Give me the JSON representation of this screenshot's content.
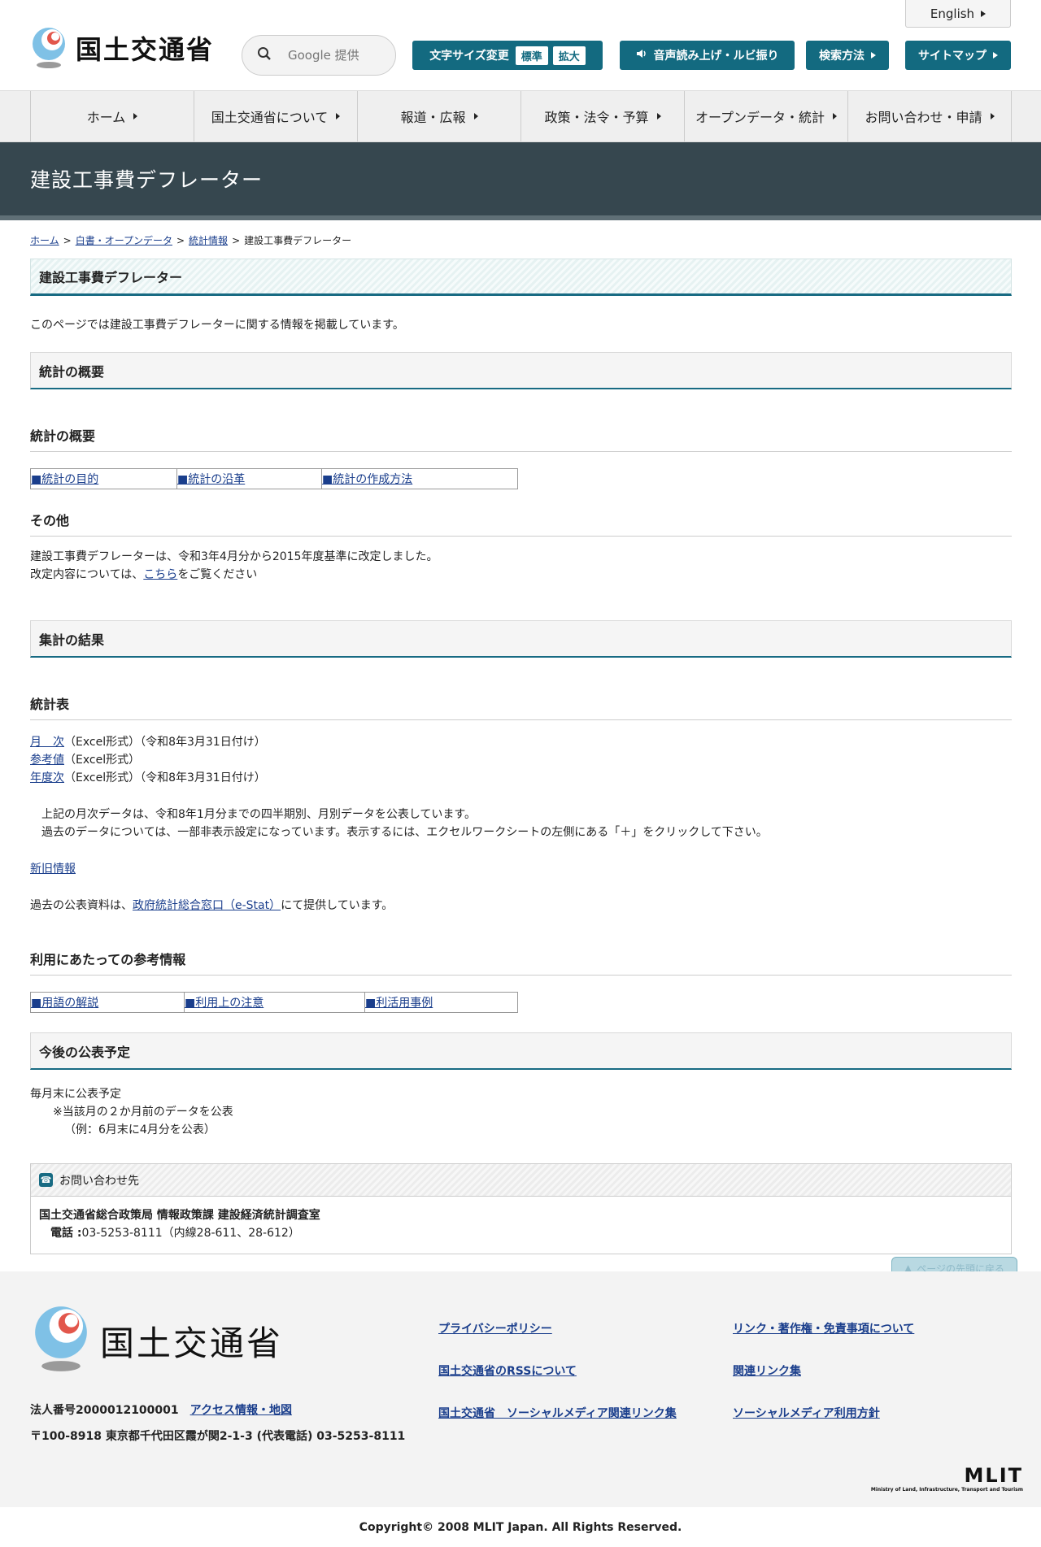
{
  "header": {
    "logo_text": "国土交通省",
    "english": "English",
    "search_placeholder": "Google 提供",
    "font_size": {
      "label": "文字サイズ変更",
      "standard": "標準",
      "large": "拡大"
    },
    "voice": "音声読み上げ・ルビ振り",
    "search_method": "検索方法",
    "sitemap": "サイトマップ"
  },
  "nav": [
    "ホーム",
    "国土交通省について",
    "報道・広報",
    "政策・法令・予算",
    "オープンデータ・統計",
    "お問い合わせ・申請"
  ],
  "page_title": "建設工事費デフレーター",
  "breadcrumb": {
    "home": "ホーム",
    "open": "白書・オープンデータ",
    "stats": "統計情報",
    "current": "建設工事費デフレーター",
    "sep": ">"
  },
  "heading": "建設工事費デフレーター",
  "lead": "このページでは建設工事費デフレーターに関する情報を掲載しています。",
  "overview": {
    "section": "統計の概要",
    "sub": "統計の概要",
    "links": [
      "■統計の目的",
      "■統計の沿革",
      "■統計の作成方法"
    ],
    "other_h": "その他",
    "other_line1": "建設工事費デフレーターは、令和3年4月分から2015年度基準に改定しました。",
    "other_pre": "改定内容については、",
    "other_link": "こちら",
    "other_post": "をご覧ください"
  },
  "results": {
    "section": "集計の結果",
    "sub": "統計表",
    "monthly_link": "月　次",
    "monthly_text": "（Excel形式）（令和8年3月31日付け）",
    "ref_link": "参考値",
    "ref_text": "（Excel形式）",
    "yearly_link": "年度次",
    "yearly_text": "（Excel形式）（令和8年3月31日付け）",
    "note1": "上記の月次データは、令和8年1月分までの四半期別、月別データを公表しています。",
    "note2": "過去のデータについては、一部非表示設定になっています。表示するには、エクセルワークシートの左側にある「＋」をクリックして下さい。",
    "newold": "新旧情報",
    "past_pre": "過去の公表資料は、",
    "past_link": "政府統計総合窓口（e-Stat）",
    "past_post": "にて提供しています。"
  },
  "reference": {
    "sub": "利用にあたっての参考情報",
    "links": [
      "■用語の解説",
      "■利用上の注意",
      "■利活用事例"
    ]
  },
  "schedule": {
    "section": "今後の公表予定",
    "line1": "毎月末に公表予定",
    "line2": "※当該月の２か月前のデータを公表",
    "line3": "（例：6月末に4月分を公表）"
  },
  "contact": {
    "title": "お問い合わせ先",
    "org": "国土交通省総合政策局 情報政策課 建設経済統計調査室",
    "phone_label": "電話 :",
    "phone": "03-5253-8111（内線28-611、28-612）"
  },
  "pagetop": "ページの先頭に戻る",
  "footer": {
    "logo_text": "国土交通省",
    "corp_no": "法人番号2000012100001",
    "access": "アクセス情報・地図",
    "address": "〒100-8918 東京都千代田区霞が関2-1-3 (代表電話) 03-5253-8111",
    "links": [
      "プライバシーポリシー",
      "リンク・著作権・免責事項について",
      "国土交通省のRSSについて",
      "関連リンク集",
      "国土交通省　ソーシャルメディア関連リンク集",
      "ソーシャルメディア利用方針"
    ],
    "mlit": "MLIT",
    "mlit_sub": "Ministry of Land, Infrastructure, Transport and Tourism"
  },
  "copyright": "Copyright© 2008 MLIT Japan. All Rights Reserved.",
  "colors": {
    "teal": "#136a80",
    "title_band": "#36474f",
    "link": "#1a3e8c"
  }
}
